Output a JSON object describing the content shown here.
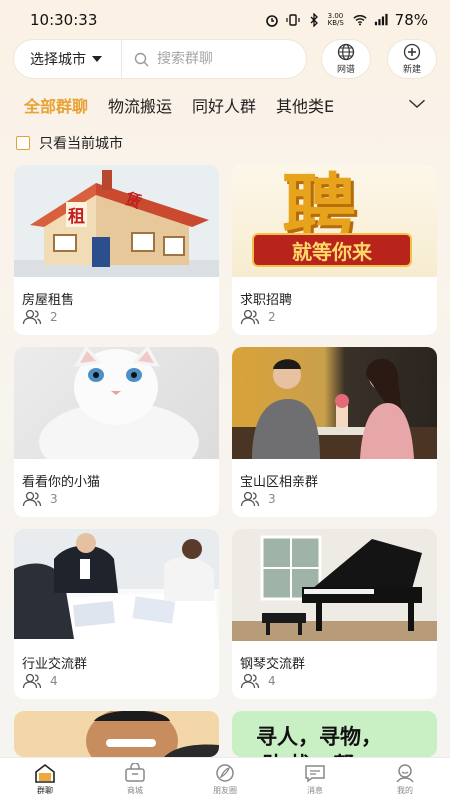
{
  "status": {
    "time": "10:30:33",
    "speed": "3.00\nKB/S",
    "battery": "78%"
  },
  "search": {
    "city_label": "选择城市",
    "placeholder": "搜索群聊"
  },
  "actions": {
    "web_label": "网谱",
    "new_label": "新建"
  },
  "tabs": [
    "全部群聊",
    "物流搬运",
    "同好人群",
    "其他类E"
  ],
  "filter": {
    "label": "只看当前城市",
    "checked": false
  },
  "cards": [
    {
      "title": "房屋租售",
      "members": "2",
      "image_text": [
        "租",
        "赁"
      ]
    },
    {
      "title": "求职招聘",
      "members": "2",
      "image_text": [
        "聘",
        "就等你来"
      ]
    },
    {
      "title": "看看你的小猫",
      "members": "3"
    },
    {
      "title": "宝山区相亲群",
      "members": "3"
    },
    {
      "title": "行业交流群",
      "members": "4"
    },
    {
      "title": "钢琴交流群",
      "members": "4"
    },
    {
      "title": "",
      "members": ""
    },
    {
      "title": "",
      "members": "",
      "image_text": [
        "寻人，寻物，",
        "助 找   帮"
      ]
    }
  ],
  "bottom_nav": [
    {
      "label": "群聊",
      "icon": "home-icon",
      "active": true
    },
    {
      "label": "商城",
      "icon": "bag-icon",
      "active": false
    },
    {
      "label": "朋友圈",
      "icon": "feather-icon",
      "active": false
    },
    {
      "label": "消息",
      "icon": "chat-icon",
      "active": false
    },
    {
      "label": "我的",
      "icon": "user-icon",
      "active": false
    }
  ],
  "colors": {
    "accent": "#e8a233",
    "background": "#faf3ea"
  }
}
